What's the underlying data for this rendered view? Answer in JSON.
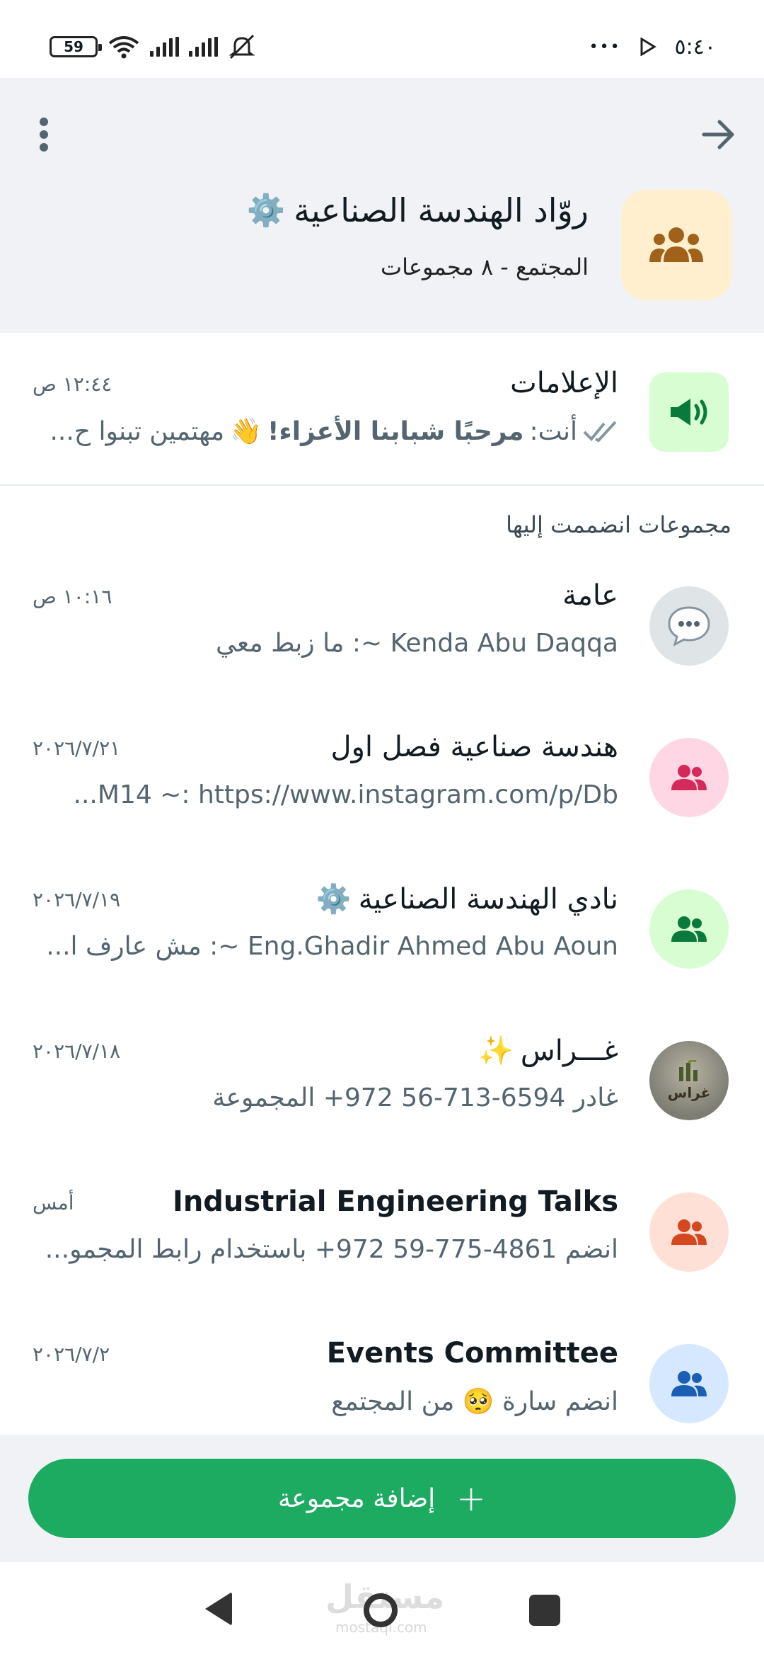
{
  "status_bar": {
    "time": "٥:٤٠",
    "battery": "59",
    "more": "•••"
  },
  "header": {
    "title": "روّاد الهندسة الصناعية",
    "title_emoji": "⚙️",
    "subtitle": "المجتمع - ٨ مجموعات"
  },
  "announcements": {
    "name": "الإعلامات",
    "time": "١٢:٤٤ ص",
    "preview_prefix": "أنت: ",
    "preview_bold": "مرحبًا شبابنا الأعزاء!",
    "preview_emoji": "👋",
    "preview_rest": " مهتمين تبنوا ح..."
  },
  "section_label": "مجموعات انضممت إليها",
  "chats": [
    {
      "name": "عامة",
      "preview": "Kenda Abu Daqqa ~: ما زبط معي",
      "time": "١٠:١٦ ص",
      "avatar_bg": "#dfe5e7",
      "avatar_icon": "speech-bubble-icon",
      "name_emoji": ""
    },
    {
      "name": "هندسة صناعية فصل اول",
      "preview": "M14 ~: https://www.instagram.com/p/Db...",
      "time": "٢٠٢٦/٧/٢١",
      "avatar_bg": "#ffd6e4",
      "avatar_icon": "group-icon",
      "icon_color": "#d42a5b",
      "name_emoji": ""
    },
    {
      "name": "نادي الهندسة الصناعية",
      "preview": "Eng.Ghadir Ahmed Abu Aoun ~: مش عارف ا...",
      "time": "٢٠٢٦/٧/١٩",
      "avatar_bg": "#d9fdd3",
      "avatar_icon": "group-icon",
      "icon_color": "#0a7a3c",
      "name_emoji": "⚙️"
    },
    {
      "name": "غـــراس",
      "preview": "غادر 6594-713-56 972+ المجموعة",
      "time": "٢٠٢٦/٧/١٨",
      "avatar_bg": "#7d7d73",
      "avatar_icon": "ghiras-logo-icon",
      "name_emoji": "✨",
      "avatar_text": "غراس"
    },
    {
      "name": "Industrial Engineering Talks",
      "preview": "انضم 4861-775-59 972+ باستخدام رابط المجمو...",
      "time": "أمس",
      "avatar_bg": "#ffe0d6",
      "avatar_icon": "group-icon",
      "icon_color": "#d4471f",
      "name_emoji": ""
    },
    {
      "name": "Events Committee",
      "preview": "انضم سارة 🥺 من المجتمع",
      "time": "٢٠٢٦/٧/٢",
      "avatar_bg": "#d6e8ff",
      "avatar_icon": "group-icon",
      "icon_color": "#1a5fb4",
      "name_emoji": ""
    }
  ],
  "add_group": {
    "label": "إضافة مجموعة",
    "plus": "+"
  },
  "watermark": {
    "text": "مستقل",
    "sub": "mostaql.com"
  },
  "colors": {
    "accent": "#1daa61",
    "header_bg": "#f0f2f5"
  }
}
